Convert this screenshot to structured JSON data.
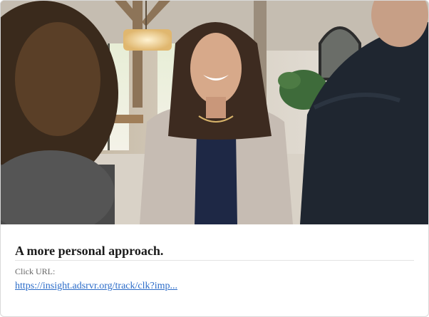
{
  "ad": {
    "image_alt": "Smiling woman in a beige blazer seated in a bright room with two people in the foreground",
    "headline": "A more personal approach.",
    "click_label": "Click URL:",
    "click_url": "https://insight.adsrvr.org/track/clk?imp..."
  },
  "colors": {
    "link": "#2a6bc8",
    "headline": "#1a1a1a"
  }
}
